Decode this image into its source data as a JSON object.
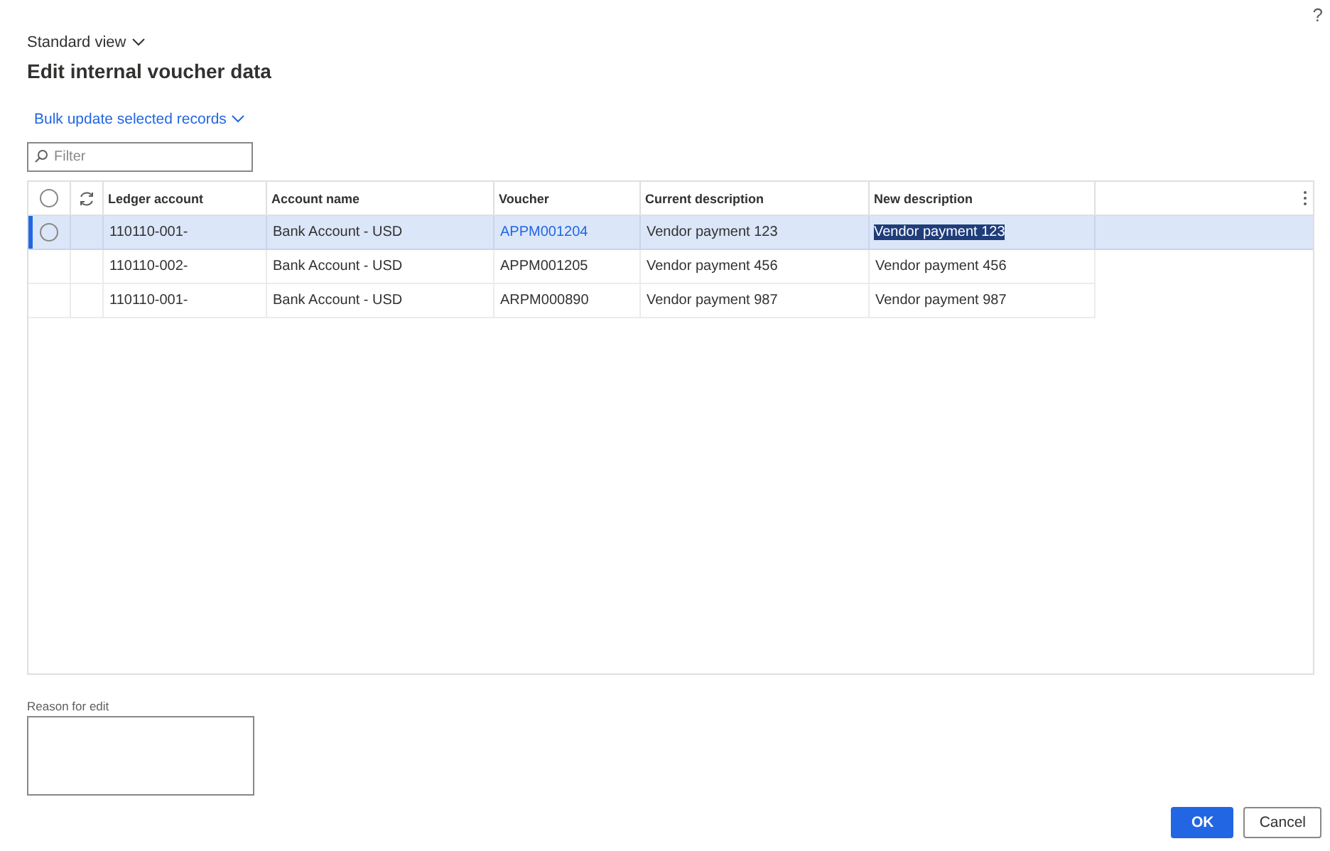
{
  "help": "?",
  "view_selector": "Standard view",
  "title": "Edit internal voucher data",
  "bulk_action": "Bulk update selected records",
  "filter": {
    "placeholder": "Filter"
  },
  "select_all": {
    "checked": false
  },
  "table": {
    "columns": [
      "Ledger account",
      "Account name",
      "Voucher",
      "Current description",
      "New description"
    ],
    "rows": [
      {
        "selected": true,
        "ledger_account": "110110-001-",
        "account_name": "Bank Account - USD",
        "voucher": "APPM001204",
        "current_description": "Vendor payment 123",
        "new_description": "Vendor payment 123"
      },
      {
        "selected": false,
        "ledger_account": "110110-002-",
        "account_name": "Bank Account - USD",
        "voucher": "APPM001205",
        "current_description": "Vendor payment 456",
        "new_description": "Vendor payment 456"
      },
      {
        "selected": false,
        "ledger_account": "110110-001-",
        "account_name": "Bank Account - USD",
        "voucher": "ARPM000890",
        "current_description": "Vendor payment 987",
        "new_description": "Vendor payment 987"
      }
    ]
  },
  "reason": {
    "label": "Reason for edit"
  },
  "buttons": [
    {
      "label": "OK",
      "kind": "primary"
    },
    {
      "label": "Cancel",
      "kind": "secondary"
    }
  ]
}
